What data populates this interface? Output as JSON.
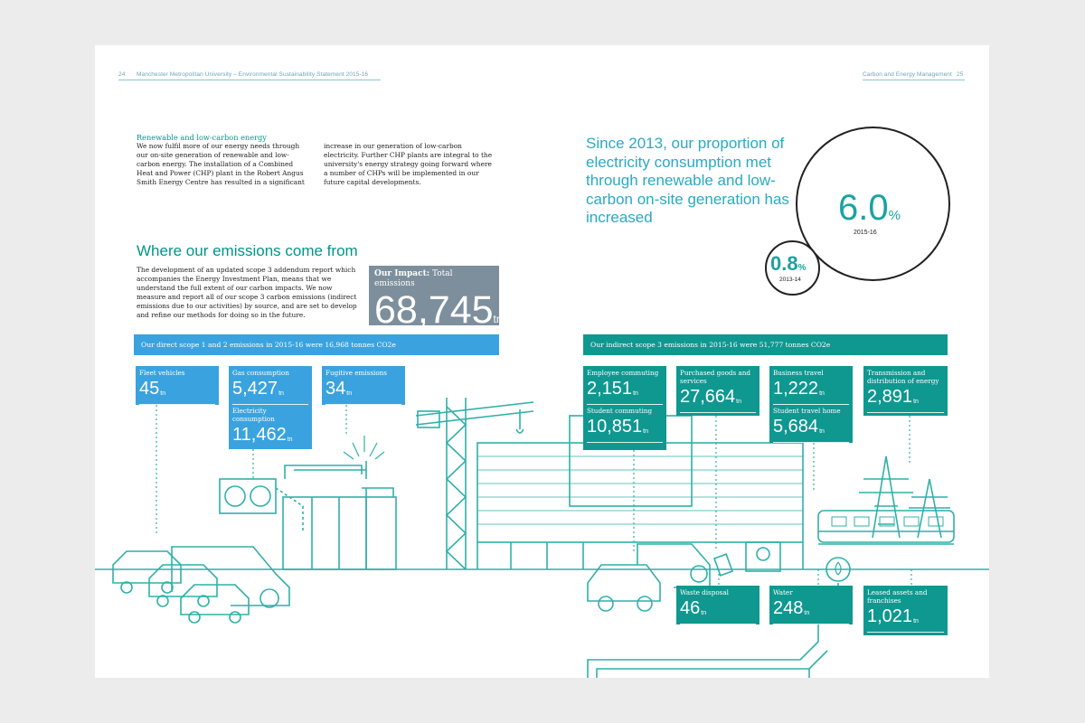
{
  "header": {
    "left_page_num": "24",
    "left_title": "Manchester Metropolitan University – Environmental Sustainability Statement 2015-16",
    "right_title": "Carbon and Energy Management",
    "right_page_num": "25"
  },
  "renewable": {
    "heading": "Renewable and low-carbon energy",
    "col1": "We now fulfil more of our energy needs through our on-site generation of renewable and low-carbon energy. The installation of a Combined Heat and Power (CHP) plant in the Robert Angus Smith Energy Centre has resulted in a significant",
    "col2": "increase in our generation of low-carbon electricity. Further CHP plants are integral to the university's energy strategy going forward where a number of CHPs will be implemented in our future capital developments."
  },
  "emissions": {
    "title": "Where our emissions come from",
    "body": "The development of an updated scope 3 addendum report which accompanies the Energy Investment Plan, means that we understand the full extent of our carbon impacts. We now measure and report all of our scope 3 carbon emissions (indirect emissions due to our activities) by source, and are set to develop and refine our methods for doing so in the future.",
    "impact_label_bold": "Our Impact:",
    "impact_label": " Total emissions",
    "impact_value": "68,745",
    "unit": "tn"
  },
  "quote": "Since 2013, our proportion of electricity consumption met through renewable and low-carbon on-site generation has increased",
  "circles": {
    "big_value": "6.0",
    "big_pct": "%",
    "big_year": "2015-16",
    "small_value": "0.8",
    "small_pct": "%",
    "small_year": "2013-14"
  },
  "banners": {
    "direct": "Our direct scope 1 and 2 emissions in 2015-16 were 16,968 tonnes CO2e",
    "indirect": "Our indirect scope 3 emissions in 2015-16 were 51,777 tonnes CO2e"
  },
  "boxes": {
    "fleet": {
      "label": "Fleet vehicles",
      "value": "45"
    },
    "gas": {
      "label": "Gas consumption",
      "value": "5,427"
    },
    "electricity": {
      "label": "Electricity consumption",
      "value": "11,462"
    },
    "fugitive": {
      "label": "Fugitive emissions",
      "value": "34"
    },
    "employee": {
      "label": "Employee commuting",
      "value": "2,151"
    },
    "student": {
      "label": "Student commuting",
      "value": "10,851"
    },
    "purchased": {
      "label": "Purchased goods and services",
      "value": "27,664"
    },
    "business": {
      "label": "Business travel",
      "value": "1,222"
    },
    "studenthome": {
      "label": "Student travel home",
      "value": "5,684"
    },
    "transmission": {
      "label": "Transmission and distribution of energy",
      "value": "2,891"
    },
    "waste": {
      "label": "Waste disposal",
      "value": "46"
    },
    "water": {
      "label": "Water",
      "value": "248"
    },
    "leased": {
      "label": "Leased assets and franchises",
      "value": "1,021"
    }
  },
  "colors": {
    "teal": "#0f9890",
    "blue": "#3aa3df",
    "impact_grey": "#7d8f9c",
    "line_teal": "#2fb1a8"
  }
}
